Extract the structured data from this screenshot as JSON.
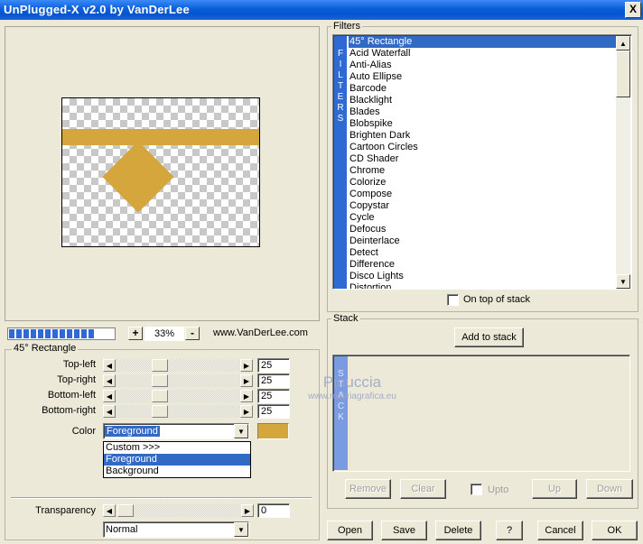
{
  "window": {
    "title": "UnPlugged-X v2.0 by VanDerLee",
    "close_glyph": "X"
  },
  "preview": {
    "band_color": "#d4a63c",
    "diamond_color": "#d4a63c"
  },
  "zoom": {
    "progress_blocks": 12,
    "plus_label": "+",
    "value": "33%",
    "minus_label": "-",
    "website": "www.VanDerLee.com"
  },
  "params": {
    "group_title": "45° Rectangle",
    "rows": [
      {
        "label": "Top-left",
        "value": "25"
      },
      {
        "label": "Top-right",
        "value": "25"
      },
      {
        "label": "Bottom-left",
        "value": "25"
      },
      {
        "label": "Bottom-right",
        "value": "25"
      }
    ],
    "color_label": "Color",
    "color_value": "Foreground",
    "color_swatch": "#d4a63c",
    "color_options": [
      "Custom >>>",
      "Foreground",
      "Background"
    ],
    "color_selected_index": 1,
    "transparency_label": "Transparency",
    "transparency_value": "0",
    "blend_value": "Normal"
  },
  "filters": {
    "group_title": "Filters",
    "side_label": [
      "F",
      "I",
      "L",
      "T",
      "E",
      "R",
      "S"
    ],
    "items": [
      "45° Rectangle",
      "Acid Waterfall",
      "Anti-Alias",
      "Auto Ellipse",
      "Barcode",
      "Blacklight",
      "Blades",
      "Blobspike",
      "Brighten Dark",
      "Cartoon Circles",
      "CD Shader",
      "Chrome",
      "Colorize",
      "Compose",
      "Copystar",
      "Cycle",
      "Defocus",
      "Deinterlace",
      "Detect",
      "Difference",
      "Disco Lights",
      "Distortion"
    ],
    "selected_index": 0,
    "on_top_label": "On top of stack"
  },
  "stack": {
    "group_title": "Stack",
    "add_label": "Add to stack",
    "side_label": [
      "S",
      "T",
      "A",
      "C",
      "K"
    ],
    "remove_label": "Remove",
    "clear_label": "Clear",
    "upto_label": "Upto",
    "up_label": "Up",
    "down_label": "Down"
  },
  "watermark": {
    "line1": "Pinuccia",
    "line2": "www.matiriagrafica.eu"
  },
  "footer": {
    "open_label": "Open",
    "save_label": "Save",
    "delete_label": "Delete",
    "help_label": "?",
    "cancel_label": "Cancel",
    "ok_label": "OK"
  }
}
